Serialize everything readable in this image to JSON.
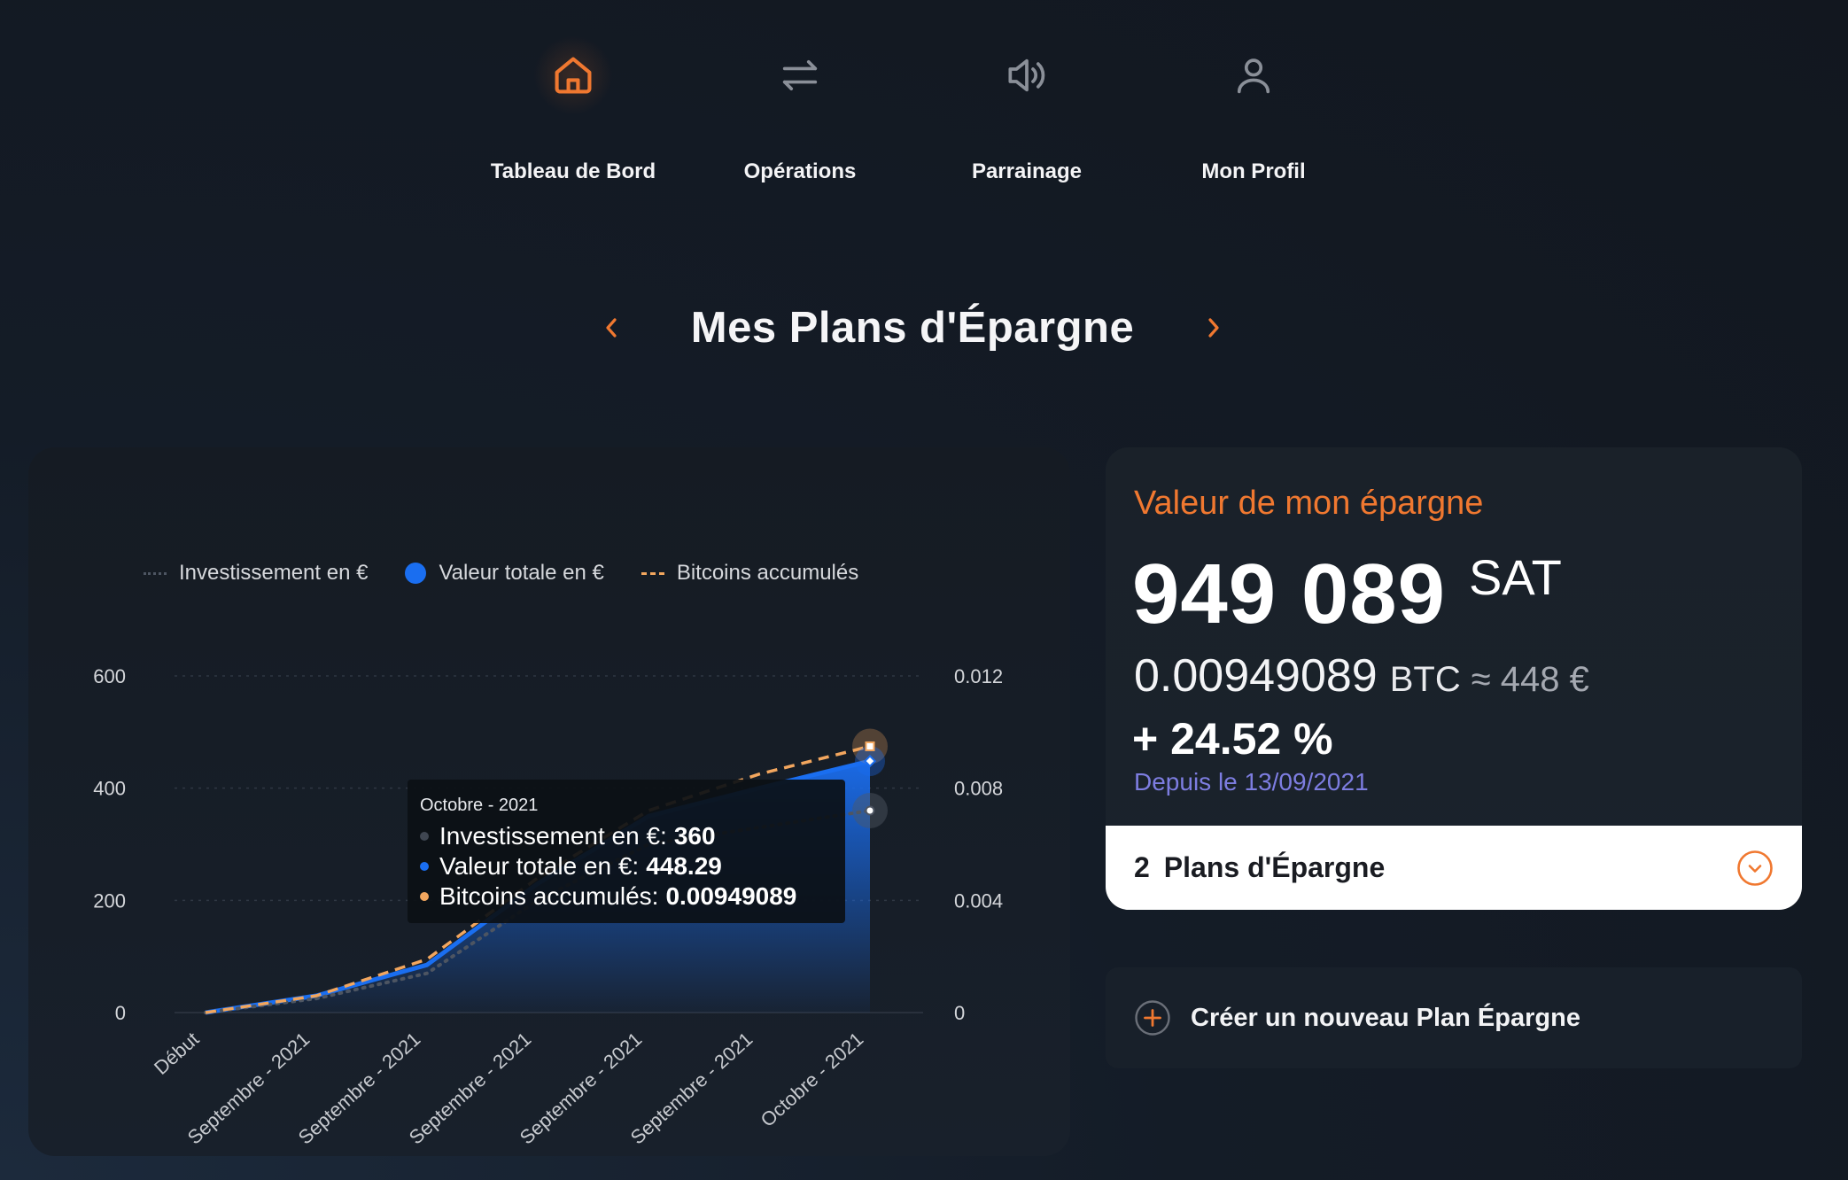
{
  "nav": {
    "items": [
      {
        "label": "Tableau de Bord",
        "icon": "home-icon",
        "active": true
      },
      {
        "label": "Opérations",
        "icon": "swap-arrows-icon",
        "active": false
      },
      {
        "label": "Parrainage",
        "icon": "speaker-icon",
        "active": false
      },
      {
        "label": "Mon Profil",
        "icon": "user-icon",
        "active": false
      }
    ]
  },
  "page_title": "Mes Plans d'Épargne",
  "colors": {
    "accent": "#f07830",
    "invest": "#4d5562",
    "value": "#1a6ef0",
    "btc": "#f2a65e",
    "since": "#7d7de0"
  },
  "chart": {
    "legend": {
      "invest": "Investissement en €",
      "value": "Valeur totale en €",
      "btc": "Bitcoins accumulés"
    },
    "tooltip": {
      "title": "Octobre - 2021",
      "invest_label": "Investissement en €:",
      "invest_value": "360",
      "value_label": "Valeur totale en €:",
      "value_value": "448.29",
      "btc_label": "Bitcoins accumulés:",
      "btc_value": "0.00949089"
    }
  },
  "chart_data": {
    "type": "line",
    "categories": [
      "Début",
      "Septembre - 2021",
      "Septembre - 2021",
      "Septembre - 2021",
      "Septembre - 2021",
      "Septembre - 2021",
      "Octobre - 2021"
    ],
    "y_left_ticks": [
      "600",
      "400",
      "200",
      "0"
    ],
    "y_right_ticks": [
      "0.012",
      "0.008",
      "0.004",
      "0"
    ],
    "ylim_left": [
      0,
      600
    ],
    "ylim_right": [
      0,
      0.012
    ],
    "grid": true,
    "legend_position": "top",
    "series": [
      {
        "name": "Investissement en €",
        "axis": "left",
        "style": "dotted",
        "values": [
          0,
          25,
          70,
          200,
          300,
          330,
          360
        ]
      },
      {
        "name": "Valeur totale en €",
        "axis": "left",
        "style": "area",
        "values": [
          0,
          30,
          85,
          230,
          350,
          400,
          448.29
        ]
      },
      {
        "name": "Bitcoins accumulés",
        "axis": "right",
        "style": "dashed",
        "values": [
          0,
          0.0006,
          0.0019,
          0.0048,
          0.0072,
          0.0085,
          0.00949089
        ]
      }
    ]
  },
  "savings": {
    "heading": "Valeur de mon épargne",
    "sat_value": "949 089",
    "sat_unit": "SAT",
    "btc_value": "0.00949089",
    "btc_unit": "BTC",
    "eur_approx": "≈ 448 €",
    "performance": "+ 24.52 %",
    "since": "Depuis le 13/09/2021",
    "plans_count": "2",
    "plans_label": "Plans d'Épargne"
  },
  "create": {
    "label": "Créer un nouveau Plan Épargne"
  }
}
